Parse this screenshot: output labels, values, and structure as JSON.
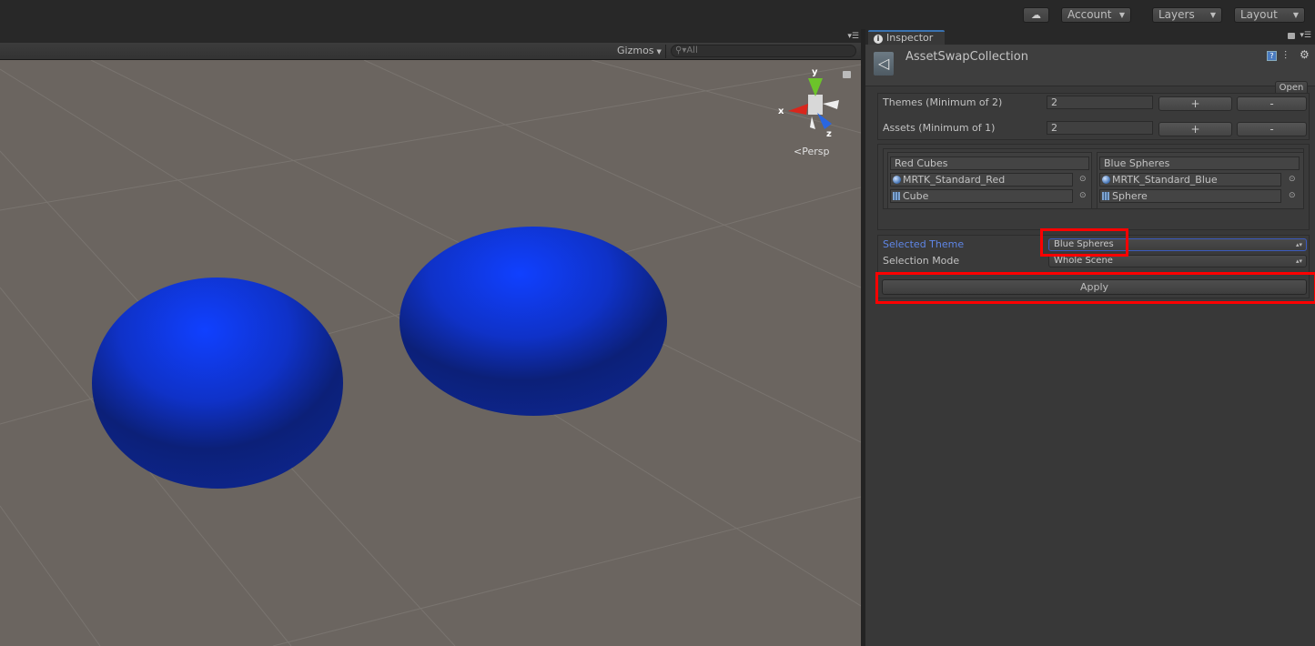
{
  "toolbar": {
    "cloud_icon": "cloud-icon",
    "account_label": "Account",
    "layers_label": "Layers",
    "layout_label": "Layout"
  },
  "scene": {
    "gizmos_label": "Gizmos",
    "search_placeholder": "All",
    "projection_label": "Persp",
    "axes": {
      "x": "x",
      "y": "y",
      "z": "z"
    },
    "objects": [
      {
        "type": "sphere",
        "color": "#1040ff"
      },
      {
        "type": "sphere",
        "color": "#1040ff"
      }
    ],
    "background_color": "#6b6560"
  },
  "inspector": {
    "tab_label": "Inspector",
    "component_title": "AssetSwapCollection",
    "open_label": "Open",
    "themes_label": "Themes (Minimum of 2)",
    "themes_value": "2",
    "assets_label": "Assets (Minimum of 1)",
    "assets_value": "2",
    "plus_label": "+",
    "minus_label": "-",
    "themes": [
      {
        "name": "Red Cubes",
        "material": "MRTK_Standard_Red",
        "mesh": "Cube"
      },
      {
        "name": "Blue Spheres",
        "material": "MRTK_Standard_Blue",
        "mesh": "Sphere"
      }
    ],
    "selected_theme_label": "Selected Theme",
    "selected_theme_value": "Blue Spheres",
    "selection_mode_label": "Selection Mode",
    "selection_mode_value": "Whole Scene",
    "apply_label": "Apply",
    "highlight_color": "#ff0000",
    "focus_label_color": "#5f86e6"
  }
}
